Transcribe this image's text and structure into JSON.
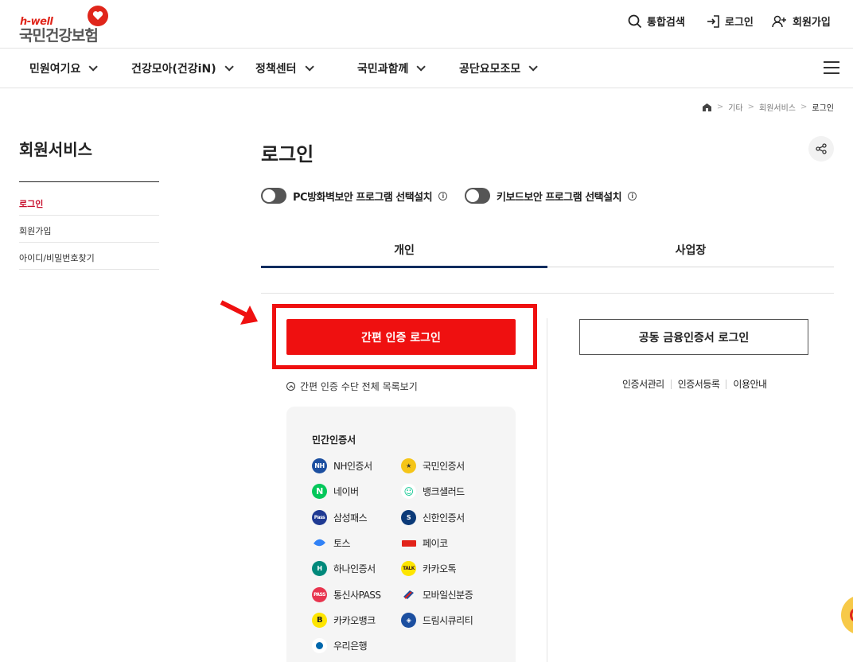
{
  "header": {
    "logo_brand": "h-well",
    "logo_name": "국민건강보험",
    "util": [
      {
        "label": "통합검색",
        "icon": "search-icon"
      },
      {
        "label": "로그인",
        "icon": "login-icon"
      },
      {
        "label": "회원가입",
        "icon": "add-user-icon"
      }
    ]
  },
  "gnb": {
    "items": [
      "민원여기요",
      "건강모아(건강iN)",
      "정책센터",
      "국민과함께",
      "공단요모조모"
    ]
  },
  "breadcrumb": {
    "items": [
      "기타",
      "회원서비스",
      "로그인"
    ]
  },
  "side": {
    "title": "회원서비스",
    "items": [
      "로그인",
      "회원가입",
      "아이디/비밀번호찾기"
    ]
  },
  "main": {
    "title": "로그인",
    "toggles": [
      {
        "label": "PC방화벽보안 프로그램 선택설치"
      },
      {
        "label": "키보드보안 프로그램 선택설치"
      }
    ],
    "tabs": [
      "개인",
      "사업장"
    ],
    "simple_login_label": "간편 인증 로그인",
    "list_all_label": "간편 인증 수단 전체 목록보기",
    "cert_panel_title": "민간인증서",
    "certs": [
      {
        "label": "NH인증서",
        "icon": "nh-icon",
        "color": "#1c4fa0"
      },
      {
        "label": "국민인증서",
        "icon": "kb-icon",
        "color": "#f5c518"
      },
      {
        "label": "네이버",
        "icon": "naver-icon",
        "color": "#03c75a"
      },
      {
        "label": "뱅크샐러드",
        "icon": "banksalad-icon",
        "color": "#00c48c"
      },
      {
        "label": "삼성패스",
        "icon": "samsung-pass-icon",
        "color": "#1f3a93"
      },
      {
        "label": "신한인증서",
        "icon": "shinhan-icon",
        "color": "#0b3a78"
      },
      {
        "label": "토스",
        "icon": "toss-icon",
        "color": "#3182f6"
      },
      {
        "label": "페이코",
        "icon": "payco-icon",
        "color": "#e2231a"
      },
      {
        "label": "하나인증서",
        "icon": "hana-icon",
        "color": "#00897b"
      },
      {
        "label": "카카오톡",
        "icon": "kakaotalk-icon",
        "color": "#fee500"
      },
      {
        "label": "통신사PASS",
        "icon": "pass-icon",
        "color": "#e8344e"
      },
      {
        "label": "모바일신분증",
        "icon": "mobile-id-icon",
        "color": "#1c4fa0"
      },
      {
        "label": "카카오뱅크",
        "icon": "kakaobank-icon",
        "color": "#fee500"
      },
      {
        "label": "드림시큐리티",
        "icon": "dream-security-icon",
        "color": "#1c4fa0"
      },
      {
        "label": "우리은행",
        "icon": "woori-icon",
        "color": "#0067ac"
      }
    ],
    "joint_cert_label": "공동 금융인증서 로그인",
    "joint_links": [
      "인증서관리",
      "인증서등록",
      "이용안내"
    ]
  },
  "colors": {
    "accent_red": "#ef1010",
    "active_tab": "#0c2d5f",
    "side_active": "#c8102e"
  }
}
